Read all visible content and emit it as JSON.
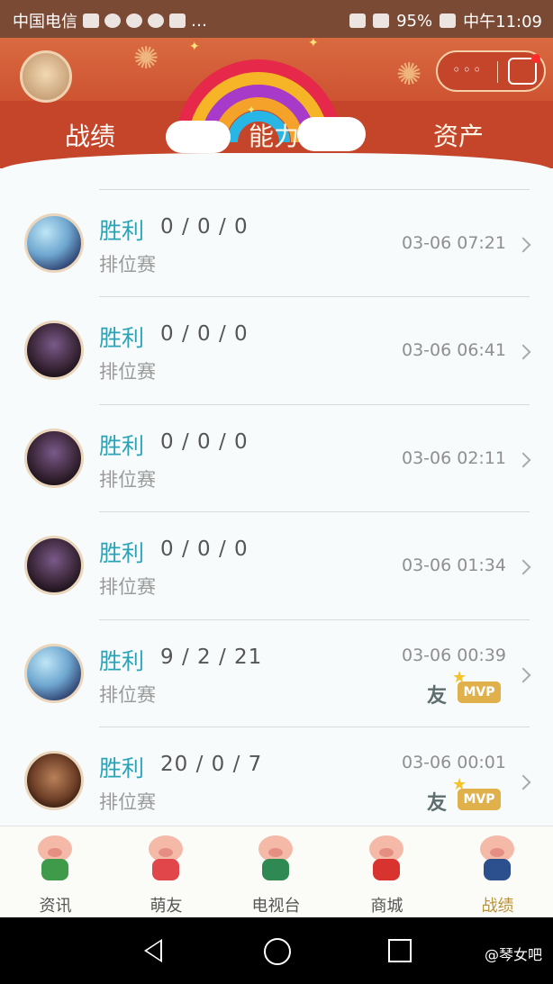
{
  "status_bar": {
    "carrier": "中国电信",
    "battery": "95%",
    "time": "中午11:09"
  },
  "header": {
    "tabs": [
      {
        "label": "战绩",
        "active": true
      },
      {
        "label": "能力",
        "active": false
      },
      {
        "label": "资产",
        "active": false
      }
    ],
    "more_label": "◦◦◦"
  },
  "matches": [
    {
      "result": "胜利",
      "kda": "0 / 0 / 0",
      "mode": "排位赛",
      "time": "03-06 07:21",
      "hero": "blue"
    },
    {
      "result": "胜利",
      "kda": "0 / 0 / 0",
      "mode": "排位赛",
      "time": "03-06 06:41",
      "hero": "dark"
    },
    {
      "result": "胜利",
      "kda": "0 / 0 / 0",
      "mode": "排位赛",
      "time": "03-06 02:11",
      "hero": "dark"
    },
    {
      "result": "胜利",
      "kda": "0 / 0 / 0",
      "mode": "排位赛",
      "time": "03-06 01:34",
      "hero": "dark"
    },
    {
      "result": "胜利",
      "kda": "9 / 2 / 21",
      "mode": "排位赛",
      "time": "03-06 00:39",
      "hero": "blue",
      "friend": "友",
      "mvp": "MVP"
    },
    {
      "result": "胜利",
      "kda": "20 / 0 / 7",
      "mode": "排位赛",
      "time": "03-06 00:01",
      "hero": "brown",
      "friend": "友",
      "mvp": "MVP"
    }
  ],
  "bottom_nav": [
    {
      "label": "资讯",
      "active": false
    },
    {
      "label": "萌友",
      "active": false
    },
    {
      "label": "电视台",
      "active": false
    },
    {
      "label": "商城",
      "active": false
    },
    {
      "label": "战绩",
      "active": true
    }
  ],
  "watermark": "@琴女吧",
  "colors": {
    "header": "#c9492b",
    "result": "#2aa3b6",
    "active_nav": "#b9923c"
  }
}
